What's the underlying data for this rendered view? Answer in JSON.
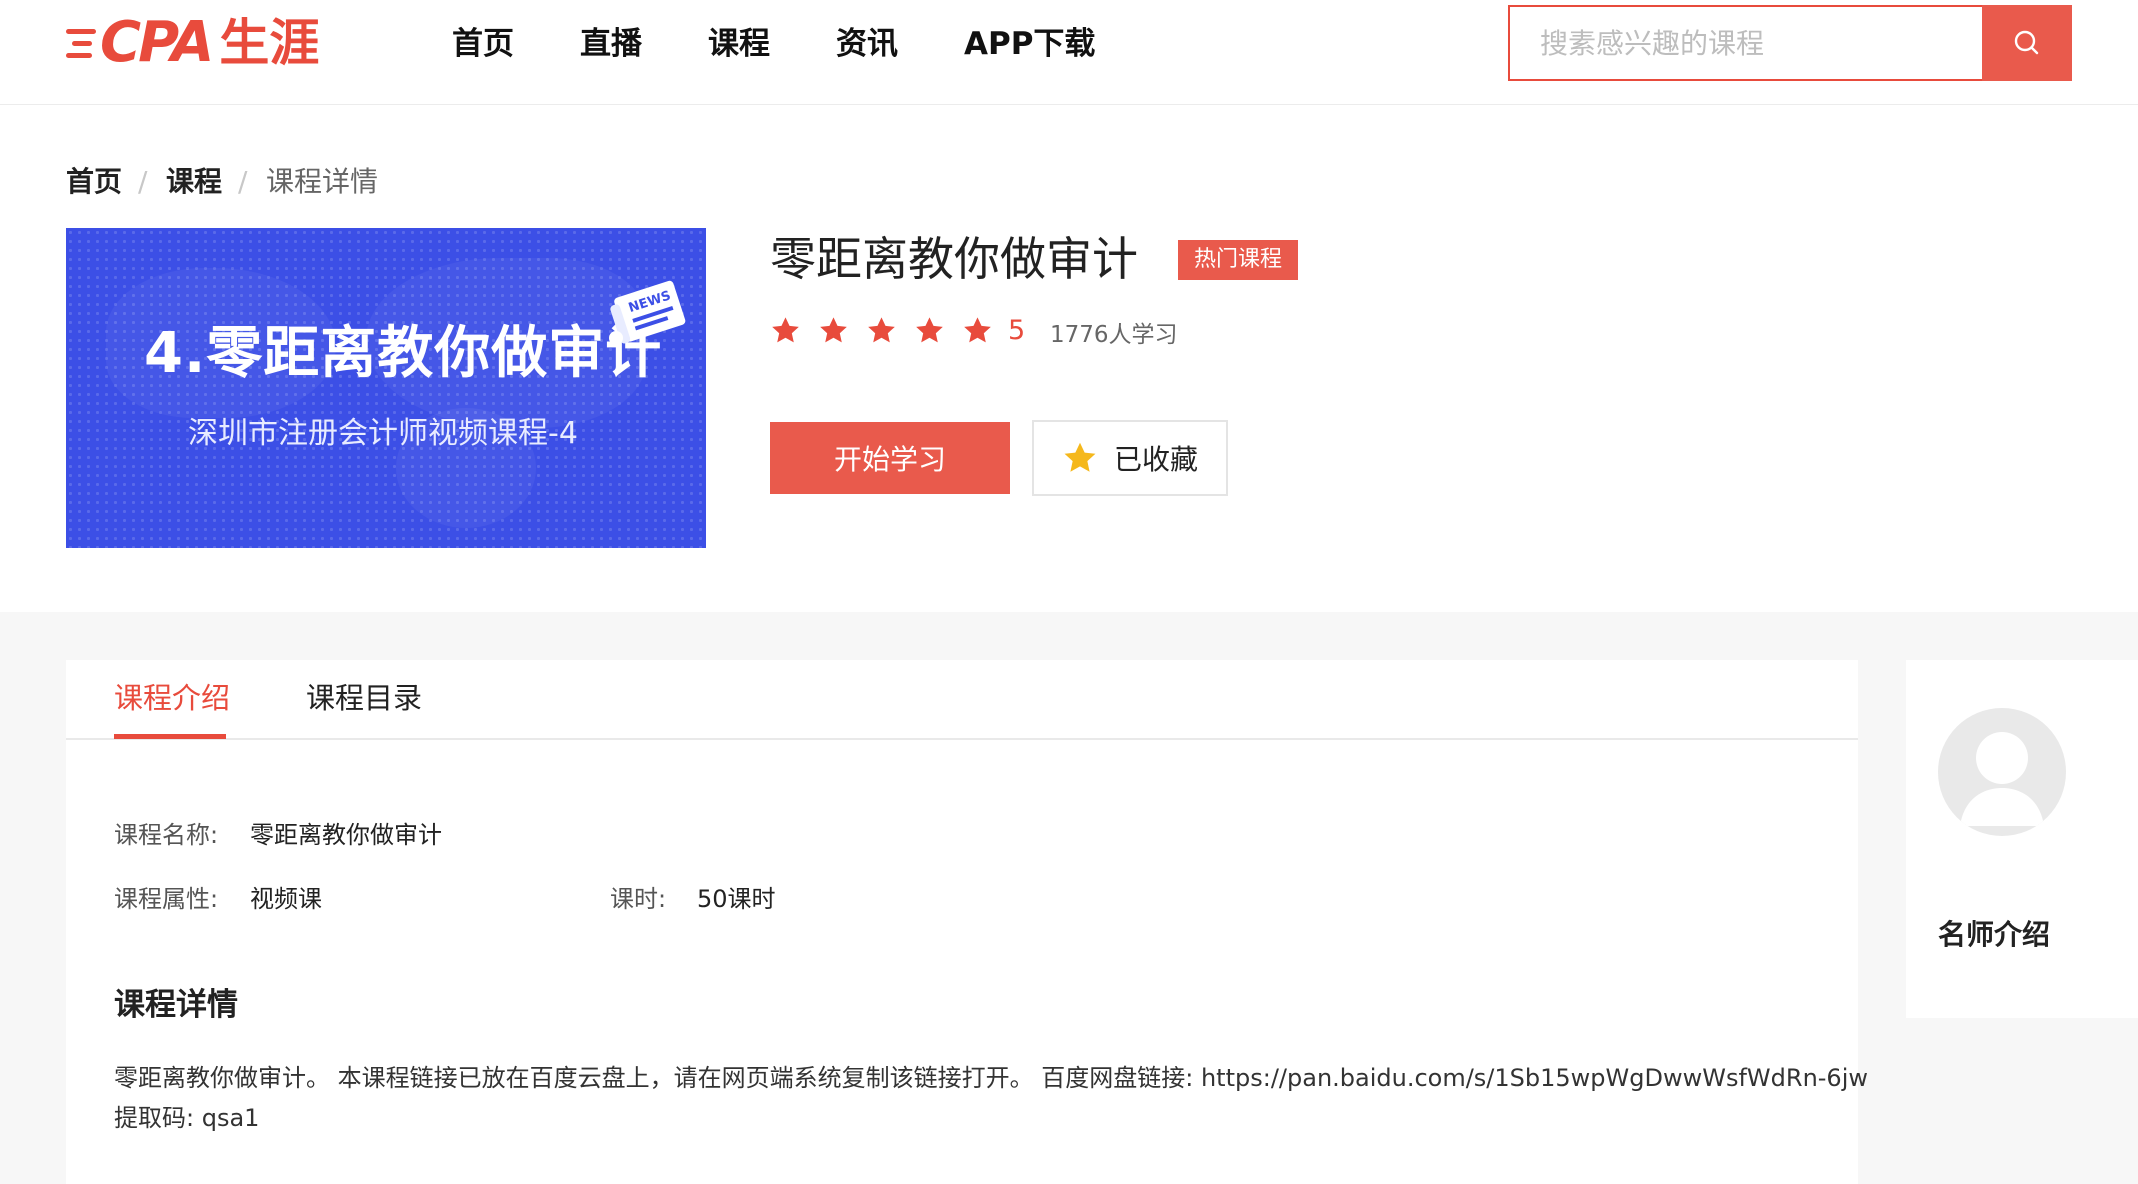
{
  "header": {
    "logo_cpa": "CPA",
    "logo_cn": "生涯",
    "nav": [
      "首页",
      "直播",
      "课程",
      "资讯",
      "APP下载"
    ],
    "search_placeholder": "搜素感兴趣的课程",
    "brand_color": "#e84b3c"
  },
  "breadcrumb": {
    "items": [
      "首页",
      "课程",
      "课程详情"
    ],
    "separator": "/"
  },
  "banner": {
    "title": "4.零距离教你做审计",
    "subtitle": "深圳市注册会计师视频课程-4",
    "news_label": "NEWS",
    "bg_color": "#3c4fe6"
  },
  "course": {
    "title": "零距离教你做审计",
    "badge": "热门课程",
    "stars": 5,
    "rating": "5",
    "learners": "1776人学习",
    "start_button": "开始学习",
    "favorite_button": "已收藏"
  },
  "tabs": [
    "课程介绍",
    "课程目录"
  ],
  "intro": {
    "name_label": "课程名称:",
    "name_value": "零距离教你做审计",
    "type_label": "课程属性:",
    "type_value": "视频课",
    "hours_label": "课时:",
    "hours_value": "50课时",
    "detail_heading": "课程详情",
    "detail_line1": "零距离教你做审计。 本课程链接已放在百度云盘上，请在网页端系统复制该链接打开。 百度网盘链接: https://pan.baidu.com/s/1Sb15wpWgDwwWsfWdRn-6jw",
    "detail_line2": "提取码: qsa1"
  },
  "teacher": {
    "label": "名师介绍"
  },
  "icons": [
    "search-icon",
    "star-icon",
    "news-icon",
    "avatar-placeholder"
  ]
}
